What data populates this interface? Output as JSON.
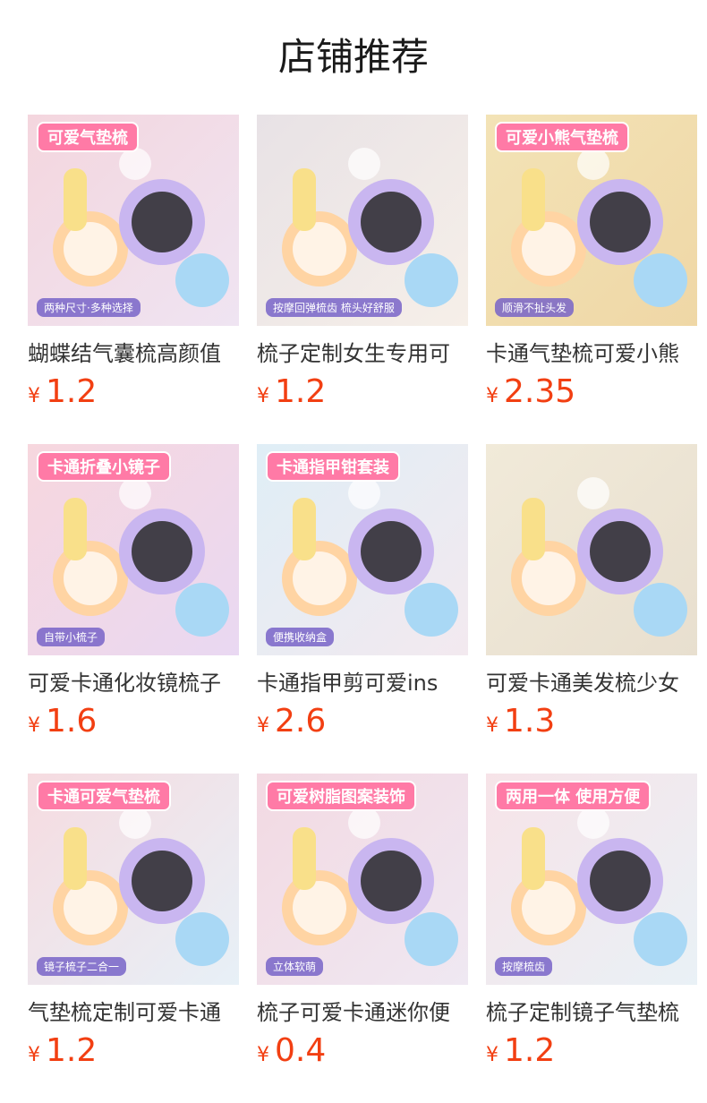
{
  "header": {
    "title": "店铺推荐"
  },
  "currency": "¥",
  "products": [
    {
      "name": "蝴蝶结气囊梳高颜值",
      "price": "1.2",
      "badge": "可爱气垫梳",
      "sub": "两种尺寸·多种选择",
      "bg": [
        "#f4d6de",
        "#efe4f2"
      ]
    },
    {
      "name": "梳子定制女生专用可",
      "price": "1.2",
      "badge": "",
      "sub": "按摩回弹梳齿 梳头好舒服",
      "bg": [
        "#e8e2e6",
        "#f6efe8"
      ]
    },
    {
      "name": "卡通气垫梳可爱小熊",
      "price": "2.35",
      "badge": "可爱小熊气垫梳",
      "sub": "顺滑不扯头发",
      "bg": [
        "#f3e3b6",
        "#efd7a6"
      ]
    },
    {
      "name": "可爱卡通化妆镜梳子",
      "price": "1.6",
      "badge": "卡通折叠小镜子",
      "sub": "自带小梳子",
      "bg": [
        "#f7d7de",
        "#e9d8f2"
      ]
    },
    {
      "name": "卡通指甲剪可爱ins",
      "price": "2.6",
      "badge": "卡通指甲钳套装",
      "sub": "便携收纳盒",
      "bg": [
        "#dfeef6",
        "#f3e9ef"
      ]
    },
    {
      "name": "可爱卡通美发梳少女",
      "price": "1.3",
      "badge": "",
      "sub": "",
      "bg": [
        "#f1ead9",
        "#e8dfcf"
      ]
    },
    {
      "name": "气垫梳定制可爱卡通",
      "price": "1.2",
      "badge": "卡通可爱气垫梳",
      "sub": "镜子梳子二合一",
      "bg": [
        "#f6dbe0",
        "#e7f0f7"
      ]
    },
    {
      "name": "梳子可爱卡通迷你便",
      "price": "0.4",
      "badge": "可爱树脂图案装饰",
      "sub": "立体软萌",
      "bg": [
        "#f3d9e2",
        "#efe8f2"
      ]
    },
    {
      "name": "梳子定制镜子气垫梳",
      "price": "1.2",
      "badge": "两用一体 使用方便",
      "sub": "按摩梳齿",
      "bg": [
        "#f7e3e8",
        "#e9f1f6"
      ]
    }
  ]
}
